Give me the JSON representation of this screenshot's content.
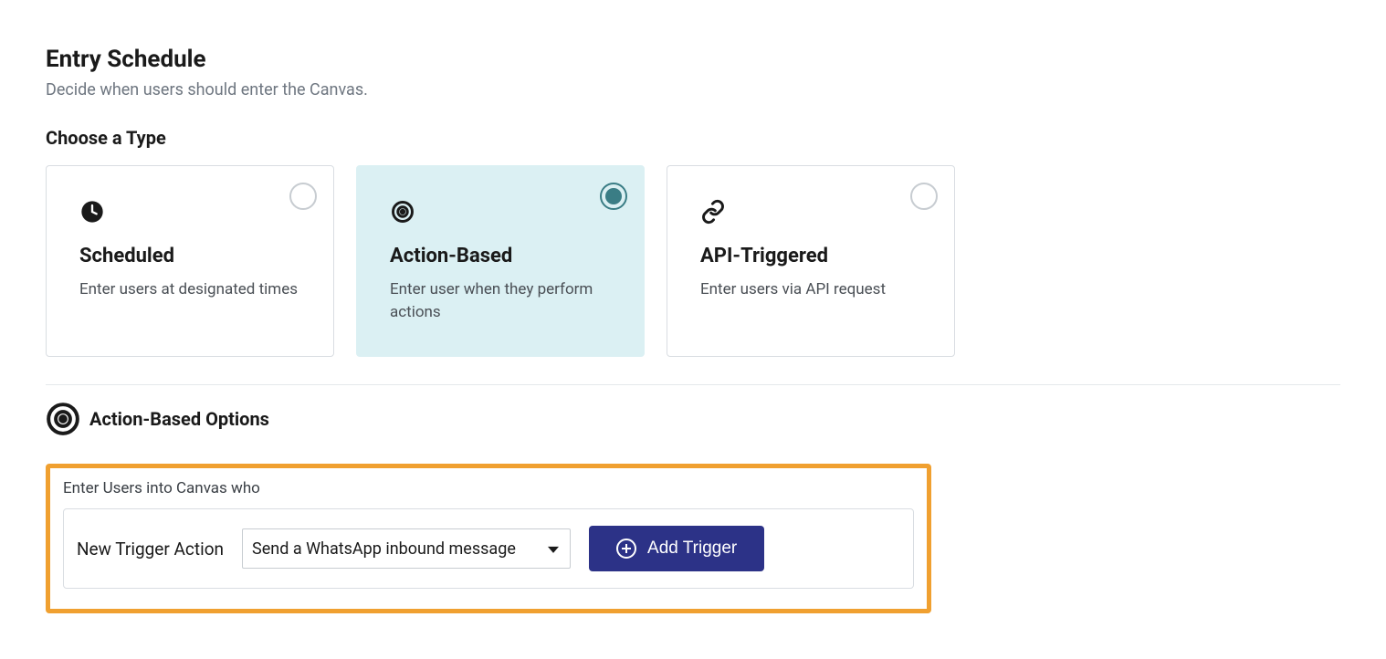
{
  "header": {
    "title": "Entry Schedule",
    "subtitle": "Decide when users should enter the Canvas."
  },
  "choose_type": {
    "label": "Choose a Type",
    "cards": [
      {
        "title": "Scheduled",
        "desc": "Enter users at designated times",
        "selected": false
      },
      {
        "title": "Action-Based",
        "desc": "Enter user when they perform actions",
        "selected": true
      },
      {
        "title": "API-Triggered",
        "desc": "Enter users via API request",
        "selected": false
      }
    ]
  },
  "options": {
    "title": "Action-Based Options",
    "enter_label": "Enter Users into Canvas who",
    "trigger_label": "New Trigger Action",
    "trigger_value": "Send a WhatsApp inbound message",
    "add_trigger_label": "Add Trigger"
  }
}
